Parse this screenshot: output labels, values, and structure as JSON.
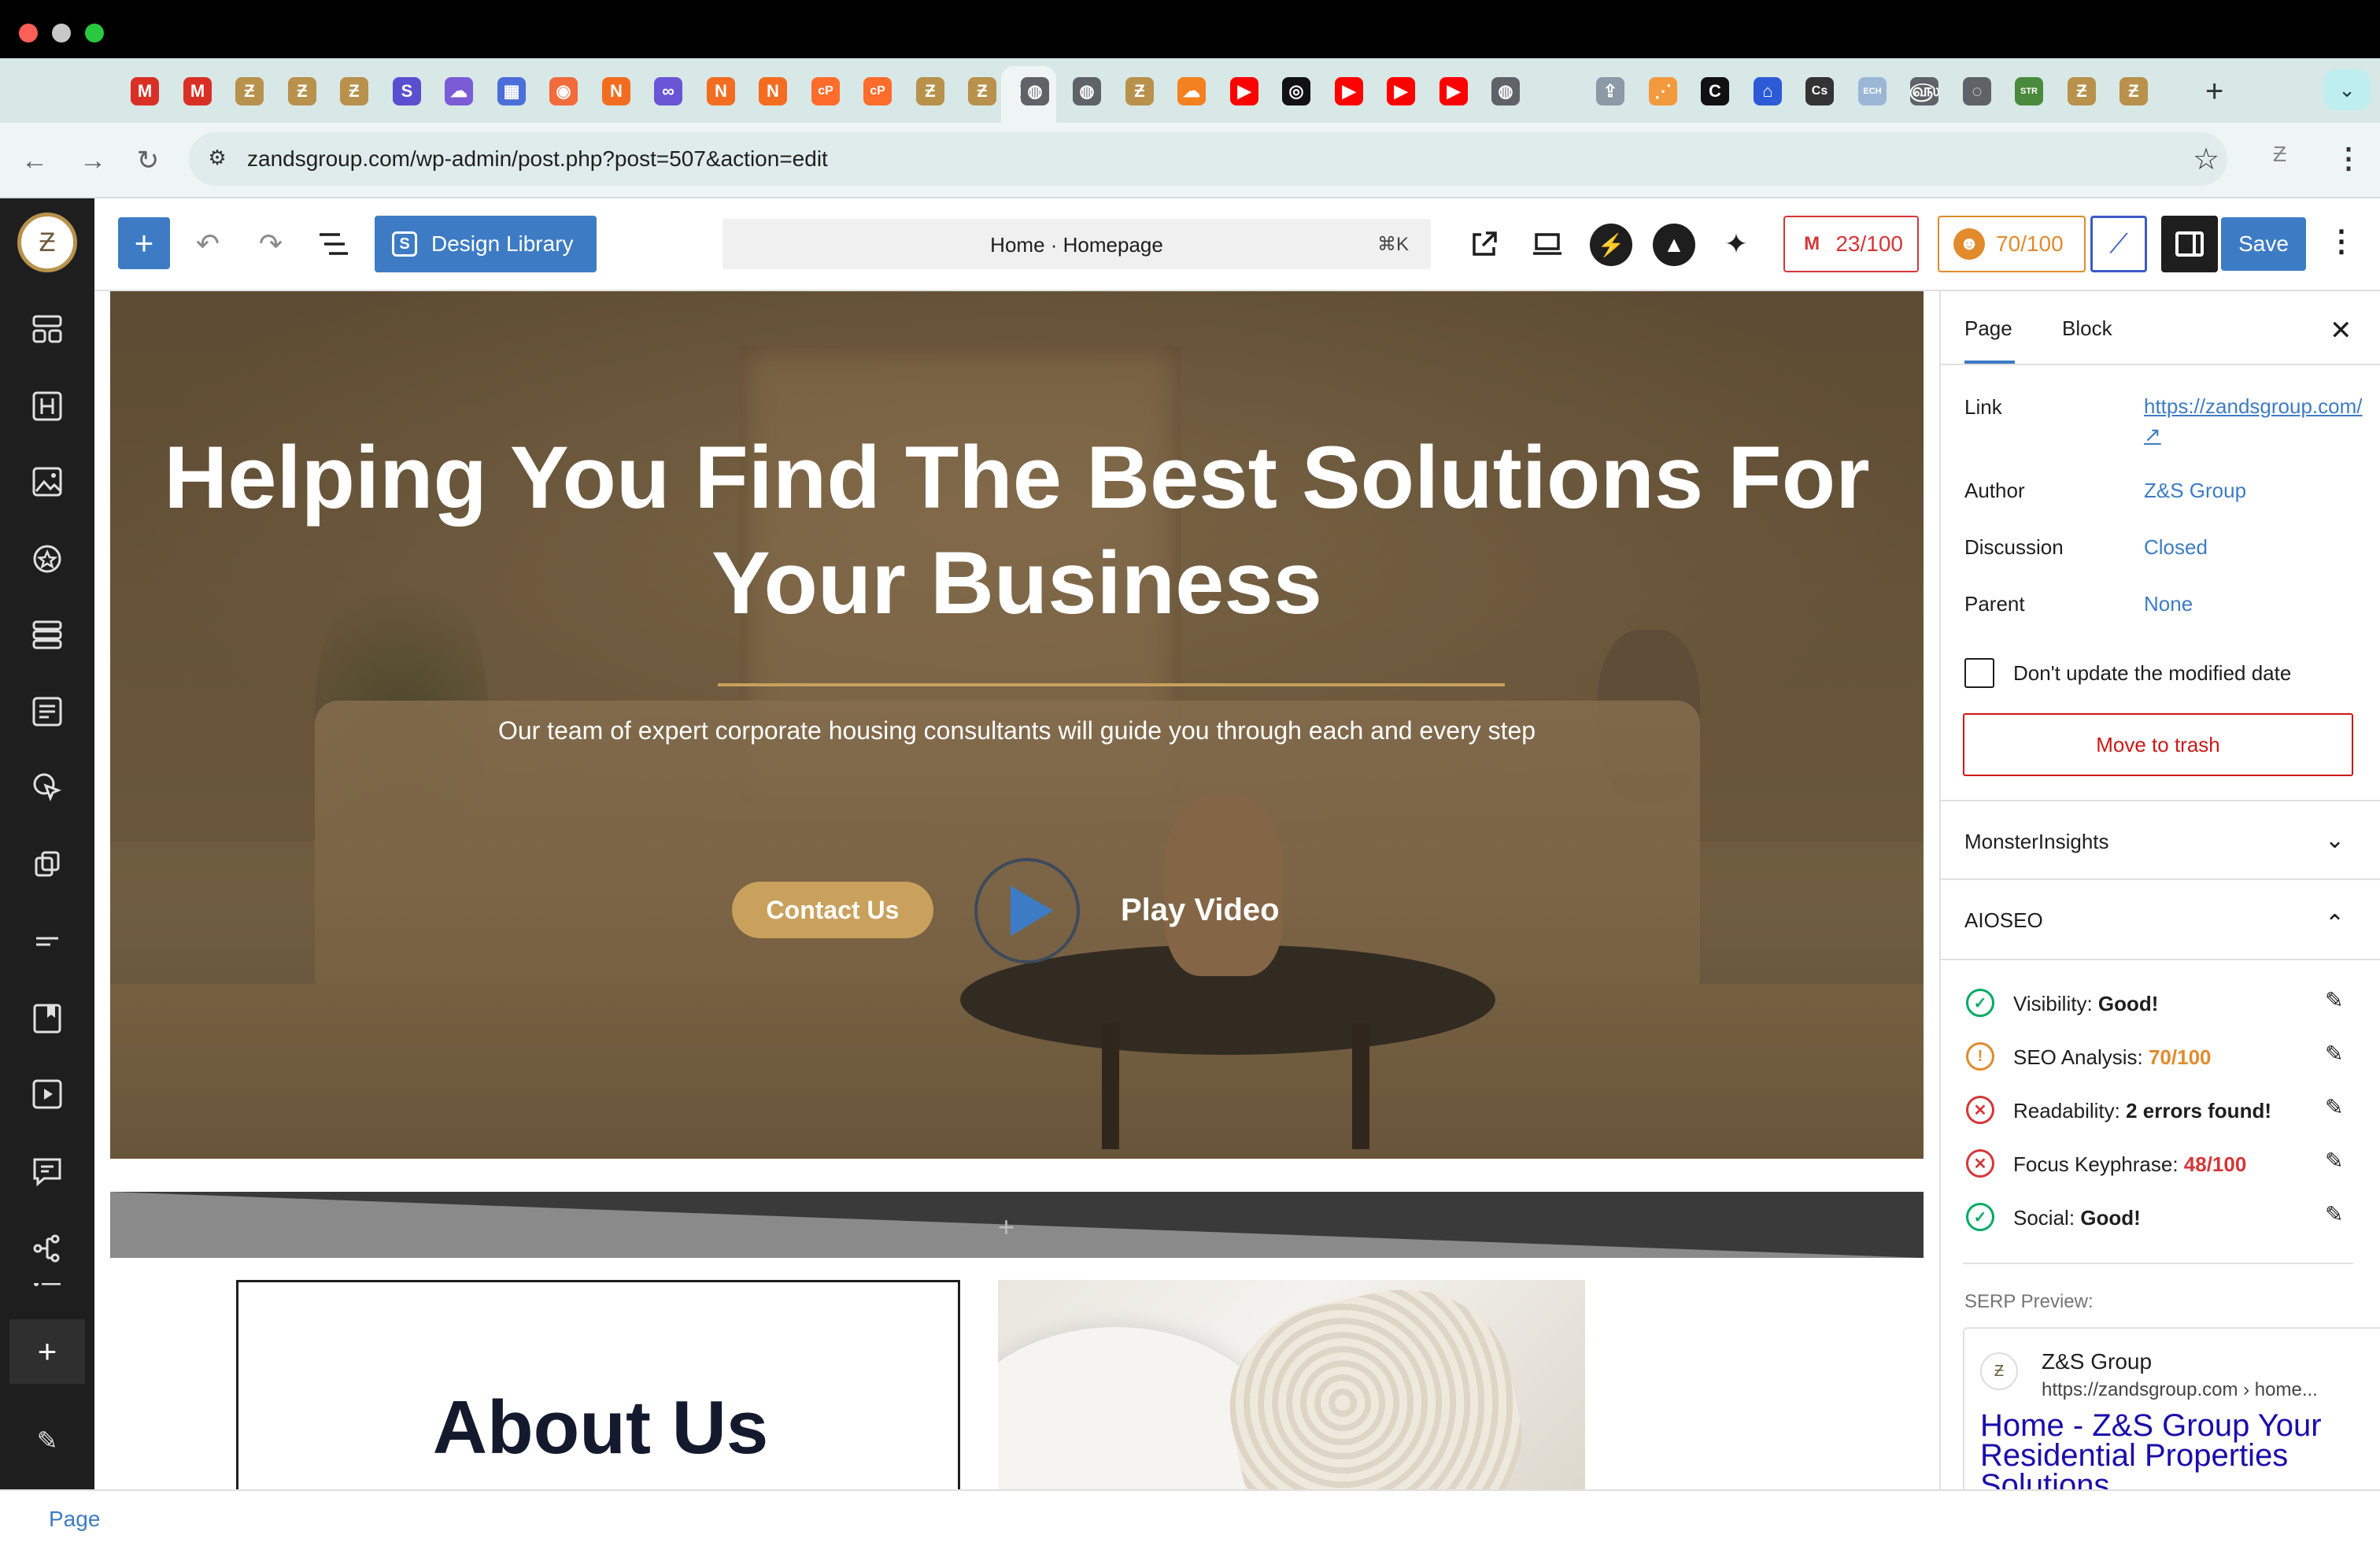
{
  "browser": {
    "url": "zandsgroup.com/wp-admin/post.php?post=507&action=edit",
    "tabs": [
      {
        "icon": "gmail-icon",
        "color": "#d93025",
        "glyph": "M"
      },
      {
        "icon": "gmail-icon",
        "color": "#d93025",
        "glyph": "M"
      },
      {
        "icon": "site-logo-icon",
        "color": "#b8914c",
        "glyph": "Ƶ"
      },
      {
        "icon": "site-logo-icon",
        "color": "#b8914c",
        "glyph": "Ƶ"
      },
      {
        "icon": "site-logo-icon",
        "color": "#b8914c",
        "glyph": "Ƶ"
      },
      {
        "icon": "s-app-icon",
        "color": "#5a4fcf",
        "glyph": "S"
      },
      {
        "icon": "cloud-app-icon",
        "color": "#7b5cd6",
        "glyph": "☁"
      },
      {
        "icon": "docs-app-icon",
        "color": "#4a6fd8",
        "glyph": "▦"
      },
      {
        "icon": "orange-app-icon",
        "color": "#f26b3a",
        "glyph": "◉"
      },
      {
        "icon": "n-app-icon",
        "color": "#f36d21",
        "glyph": "N"
      },
      {
        "icon": "infinity-icon",
        "color": "#6a55d6",
        "glyph": "∞"
      },
      {
        "icon": "n-app-icon",
        "color": "#f36d21",
        "glyph": "N"
      },
      {
        "icon": "n-app-icon",
        "color": "#f36d21",
        "glyph": "N"
      },
      {
        "icon": "cpanel-icon",
        "color": "#ff6c2c",
        "glyph": "cP"
      },
      {
        "icon": "cpanel-icon",
        "color": "#ff6c2c",
        "glyph": "cP"
      },
      {
        "icon": "site-logo-icon",
        "color": "#b8914c",
        "glyph": "Ƶ"
      },
      {
        "icon": "site-logo-icon",
        "color": "#b8914c",
        "glyph": "Ƶ"
      },
      {
        "icon": "globe-icon",
        "color": "#5f6368",
        "glyph": "◍"
      },
      {
        "icon": "globe-icon",
        "color": "#5f6368",
        "glyph": "◍"
      },
      {
        "icon": "site-logo-icon",
        "color": "#b8914c",
        "glyph": "Ƶ"
      },
      {
        "icon": "cloudflare-icon",
        "color": "#f48120",
        "glyph": "☁"
      },
      {
        "icon": "youtube-icon",
        "color": "#ff0000",
        "glyph": "▶"
      },
      {
        "icon": "openai-icon",
        "color": "#111111",
        "glyph": "◎"
      },
      {
        "icon": "youtube-icon",
        "color": "#ff0000",
        "glyph": "▶"
      },
      {
        "icon": "youtube-icon",
        "color": "#ff0000",
        "glyph": "▶"
      },
      {
        "icon": "youtube-icon",
        "color": "#ff0000",
        "glyph": "▶"
      },
      {
        "icon": "globe-icon",
        "color": "#5f6368",
        "glyph": "◍"
      },
      {
        "icon": "blank-tab-icon",
        "color": "#d7e8e6",
        "glyph": ""
      },
      {
        "icon": "upload-icon",
        "color": "#8a9aa6",
        "glyph": "⇪"
      },
      {
        "icon": "share-icon",
        "color": "#f29a3d",
        "glyph": "⋰"
      },
      {
        "icon": "dark-app-icon",
        "color": "#111111",
        "glyph": "C"
      },
      {
        "icon": "home-app-icon",
        "color": "#2d5bd8",
        "glyph": "⌂"
      },
      {
        "icon": "cs-app-icon",
        "color": "#333333",
        "glyph": "Cs"
      },
      {
        "icon": "ech-app-icon",
        "color": "#9bb7d6",
        "glyph": "ECH"
      },
      {
        "icon": "fingerprint-icon",
        "color": "#5f6368",
        "glyph": "௵"
      },
      {
        "icon": "loading-icon",
        "color": "#5f6368",
        "glyph": "◌"
      },
      {
        "icon": "str-hub-icon",
        "color": "#4a8a3d",
        "glyph": "STR"
      },
      {
        "icon": "site-logo-icon",
        "color": "#b8914c",
        "glyph": "Ƶ"
      },
      {
        "icon": "site-logo-icon",
        "color": "#b8914c",
        "glyph": "Ƶ"
      }
    ]
  },
  "editor": {
    "design_library_label": "Design Library",
    "command_title": "Home · Homepage",
    "command_shortcut": "⌘K",
    "seo_head_score": "23/100",
    "aioseo_score": "70/100",
    "save_label": "Save"
  },
  "hero": {
    "title": "Helping You Find The Best Solutions For Your Business",
    "subtitle": "Our team of expert corporate housing consultants will guide you through each and every step",
    "contact_label": "Contact Us",
    "play_label": "Play Video",
    "accent_color": "#c9a15c"
  },
  "about": {
    "title": "About Us"
  },
  "settings": {
    "tabs": [
      "Page",
      "Block"
    ],
    "link_label": "Link",
    "link_value": "https://zandsgroup.com/ ↗",
    "author_label": "Author",
    "author_value": "Z&S Group",
    "discussion_label": "Discussion",
    "discussion_value": "Closed",
    "parent_label": "Parent",
    "parent_value": "None",
    "checkbox_label": "Don't update the modified date",
    "trash_label": "Move to trash",
    "panels": {
      "monsterinsights": "MonsterInsights",
      "aioseo": "AIOSEO"
    },
    "seo_checks": [
      {
        "label": "Visibility: ",
        "value": "Good!",
        "status": "good"
      },
      {
        "label": "SEO Analysis: ",
        "value": "70/100",
        "status": "warn"
      },
      {
        "label": "Readability: ",
        "value": "2 errors found!",
        "status": "bad"
      },
      {
        "label": "Focus Keyphrase: ",
        "value": "48/100",
        "status": "bad"
      },
      {
        "label": "Social: ",
        "value": "Good!",
        "status": "good"
      }
    ],
    "serp": {
      "label": "SERP Preview:",
      "site": "Z&S Group",
      "url": "https://zandsgroup.com › home...",
      "title": "Home - Z&S Group Your Residential Properties Solutions"
    }
  },
  "footer": {
    "breadcrumb": "Page"
  }
}
